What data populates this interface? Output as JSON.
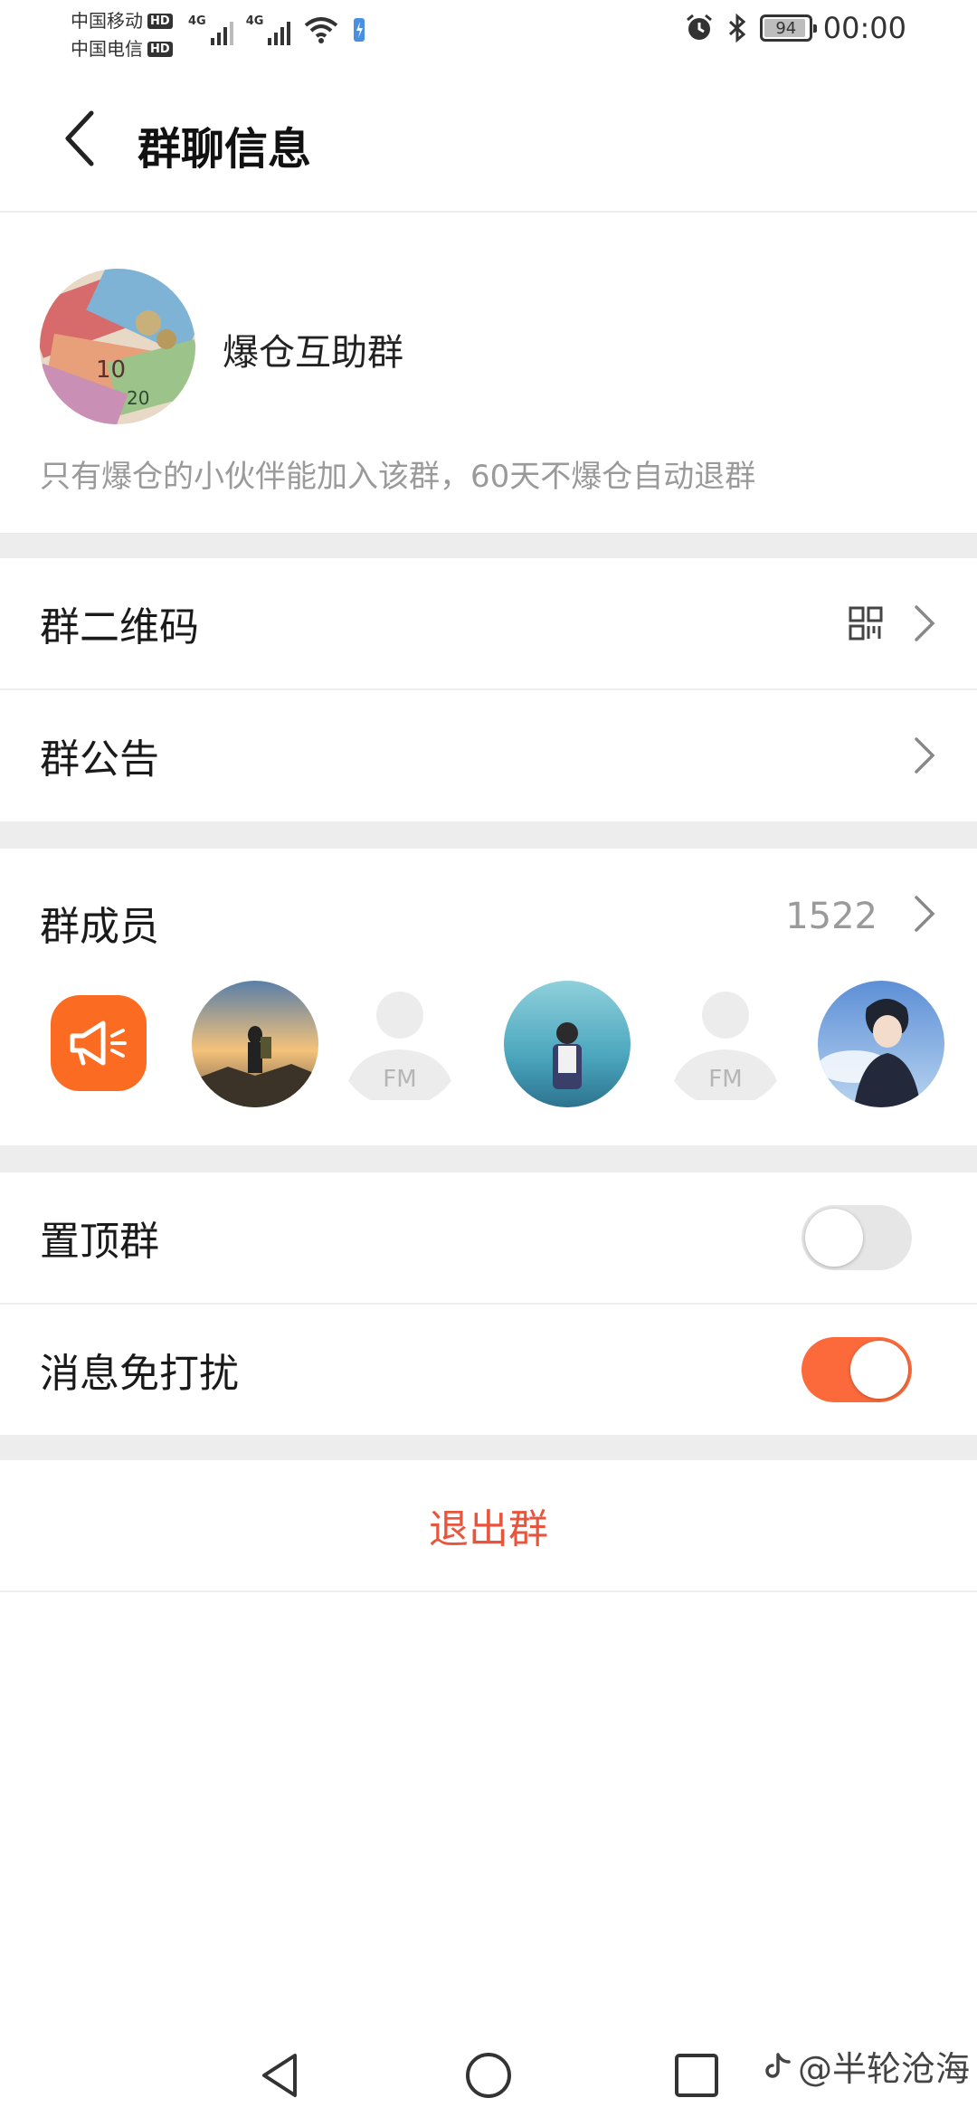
{
  "status_bar": {
    "carriers": [
      {
        "name": "中国移动",
        "hd": "HD"
      },
      {
        "name": "中国电信",
        "hd": "HD"
      }
    ],
    "network_tags": [
      "4G",
      "4G"
    ],
    "battery_percent": "94",
    "battery_level": 0.94,
    "time": "00:00"
  },
  "header": {
    "title": "群聊信息",
    "back_icon": "chevron-left-icon"
  },
  "group": {
    "name": "爆仓互助群",
    "description": "只有爆仓的小伙伴能加入该群，60天不爆仓自动退群"
  },
  "rows": {
    "qr_code": {
      "label": "群二维码",
      "icon": "qr-code-icon"
    },
    "announcement": {
      "label": "群公告"
    },
    "members": {
      "label": "群成员",
      "count": "1522"
    },
    "pin": {
      "label": "置顶群",
      "enabled": false
    },
    "mute": {
      "label": "消息免打扰",
      "enabled": true
    }
  },
  "member_avatars": [
    {
      "type": "announcement",
      "icon": "megaphone-icon"
    },
    {
      "type": "photo",
      "icon": "hiker-photo"
    },
    {
      "type": "placeholder",
      "text": "FM"
    },
    {
      "type": "photo",
      "icon": "backpacker-photo"
    },
    {
      "type": "placeholder",
      "text": "FM"
    },
    {
      "type": "photo",
      "icon": "anime-boy-photo"
    }
  ],
  "exit_button": {
    "label": "退出群"
  },
  "colors": {
    "accent": "#fc6a3b",
    "exit_red": "#e8543c",
    "section_gap": "#ededed",
    "muted_text": "#9a9a9a"
  },
  "watermark": {
    "text": "@半轮沧海"
  }
}
